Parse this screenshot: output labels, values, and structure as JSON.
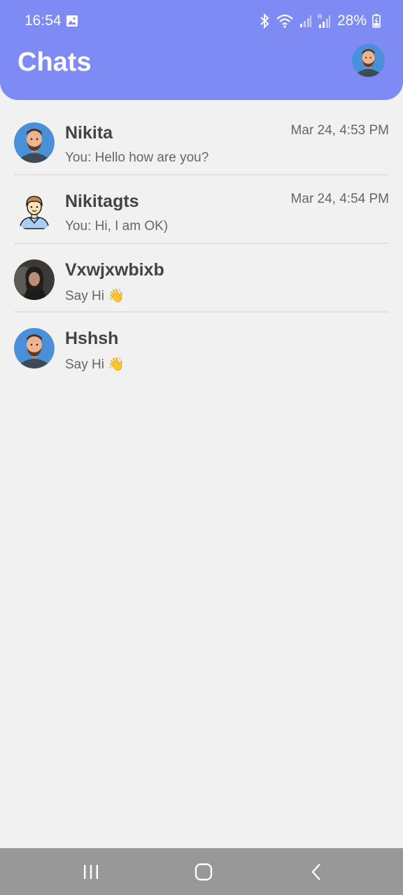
{
  "status_bar": {
    "time": "16:54",
    "battery": "28%",
    "icons": [
      "gallery-icon",
      "bluetooth-icon",
      "wifi-icon",
      "signal-icon",
      "signal-roaming-icon",
      "battery-icon"
    ]
  },
  "header": {
    "title": "Chats",
    "background": "#7f8bf4",
    "profile_avatar": "bearded-man-avatar"
  },
  "chats": [
    {
      "name": "Nikita",
      "preview": "You: Hello how are you?",
      "time": "Mar 24, 4:53 PM",
      "avatar": "bearded-man-avatar"
    },
    {
      "name": "Nikitagts",
      "preview": "You: Hi, I am OK)",
      "time": "Mar 24, 4:54 PM",
      "avatar": "cartoon-man-avatar"
    },
    {
      "name": "Vxwjxwbixb",
      "preview": "Say Hi 👋",
      "time": "",
      "avatar": "photo-avatar"
    },
    {
      "name": "Hshsh",
      "preview": "Say Hi 👋",
      "time": "",
      "avatar": "bearded-man-avatar"
    }
  ],
  "nav_bar": {
    "buttons": [
      "recent-apps-icon",
      "home-icon",
      "back-icon"
    ]
  }
}
